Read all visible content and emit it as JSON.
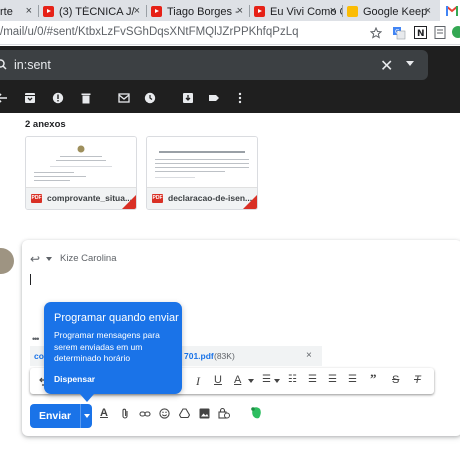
{
  "browser": {
    "tabs": [
      {
        "label": "rte",
        "icon": "generic-tab-icon",
        "close": "×"
      },
      {
        "label": "(3) TÉCNICA J/",
        "icon": "youtube-icon",
        "close": "×"
      },
      {
        "label": "Tiago Borges -",
        "icon": "youtube-icon",
        "close": "×"
      },
      {
        "label": "Eu Vivi Como C",
        "icon": "youtube-icon",
        "close": "×"
      },
      {
        "label": "Google Keep",
        "icon": "google-keep-icon",
        "close": "×"
      },
      {
        "label": "",
        "icon": "gmail-icon",
        "close": ""
      }
    ],
    "url_prefix": "/mail/u/0/",
    "url_rest": "#sent/KtbxLzFvSGhDqsXNtFMQlJZrPPKhfqPzLq"
  },
  "search": {
    "value": "in:sent",
    "close": "✕"
  },
  "message": {
    "attachments_title": "2 anexos",
    "attachments": [
      {
        "name": "comprovante_situa...",
        "type": "PDF"
      },
      {
        "name": "declaracao-de-isen...",
        "type": "PDF"
      }
    ]
  },
  "reply": {
    "recipient": "Kize Carolina",
    "attached_file_prefix": "co",
    "attached_file": "701.pdf",
    "attached_size": "(83K)",
    "remove": "×",
    "dots": "•••"
  },
  "tooltip": {
    "title": "Programar quando enviar",
    "body": "Programar mensagens para serem enviadas em um determinado horário",
    "dismiss": "Dispensar"
  },
  "compose": {
    "send_label": "Enviar"
  },
  "colors": {
    "accent": "#1a73e8",
    "dark_header": "#1f1f1f",
    "search_bg": "#3c4043"
  }
}
